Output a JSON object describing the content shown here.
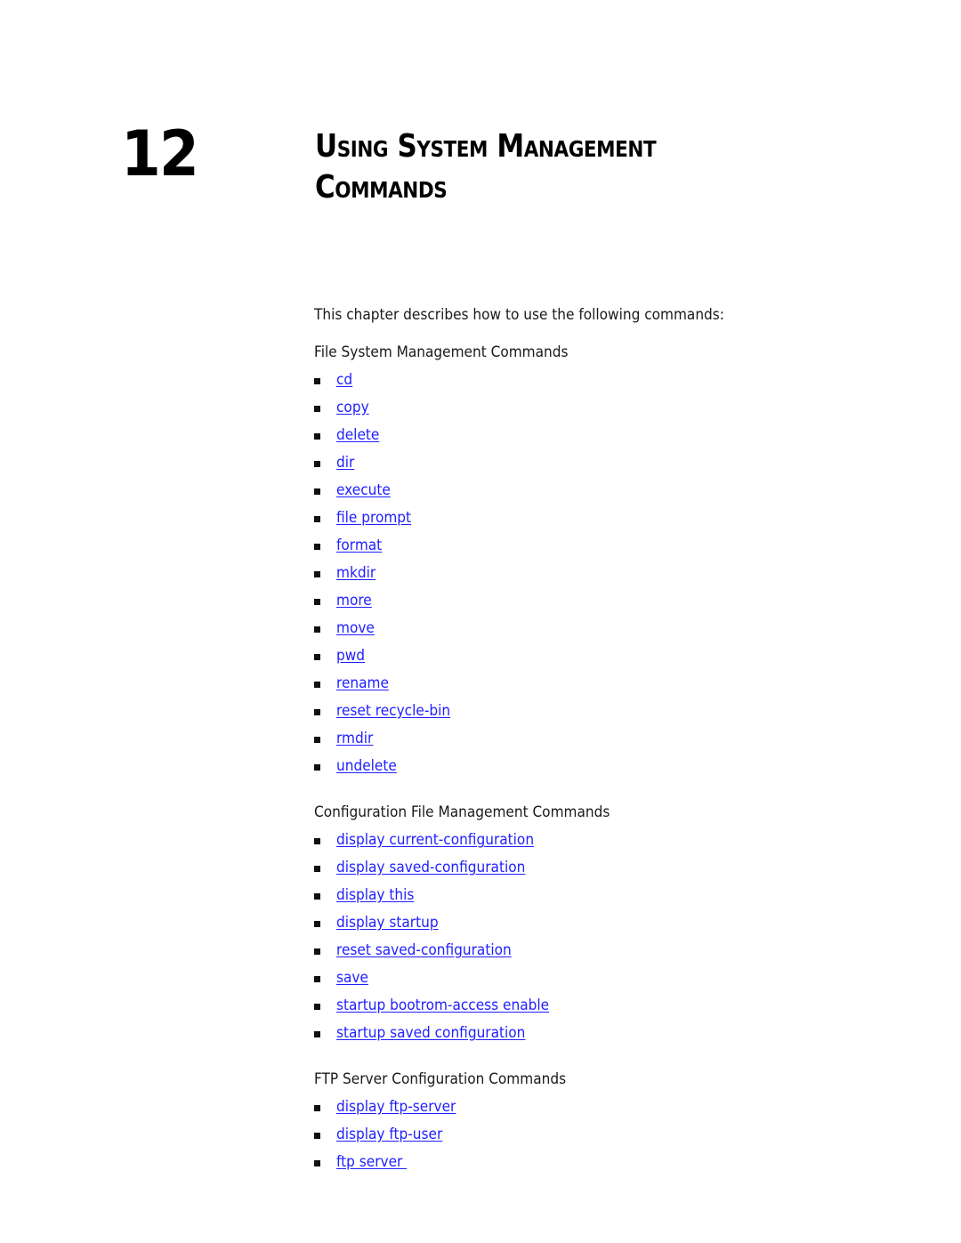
{
  "chapter": {
    "number": "12",
    "title_line1": "Using System Management",
    "title_line2": "Commands"
  },
  "intro": "This chapter describes how to use the following commands:",
  "link_color": "#1f1fff",
  "sections": [
    {
      "heading": "File System Management Commands",
      "items": [
        "cd",
        "copy",
        "delete",
        "dir",
        "execute",
        "file prompt",
        "format",
        "mkdir",
        "more",
        "move",
        "pwd",
        "rename",
        "reset recycle-bin",
        "rmdir",
        "undelete"
      ]
    },
    {
      "heading": "Configuration File Management Commands",
      "items": [
        "display current-configuration",
        "display saved-configuration",
        "display this",
        "display startup",
        "reset saved-configuration",
        "save",
        "startup bootrom-access enable",
        "startup saved configuration"
      ]
    },
    {
      "heading": "FTP Server Configuration Commands",
      "items": [
        "display ftp-server",
        "display ftp-user",
        "ftp server "
      ]
    }
  ]
}
